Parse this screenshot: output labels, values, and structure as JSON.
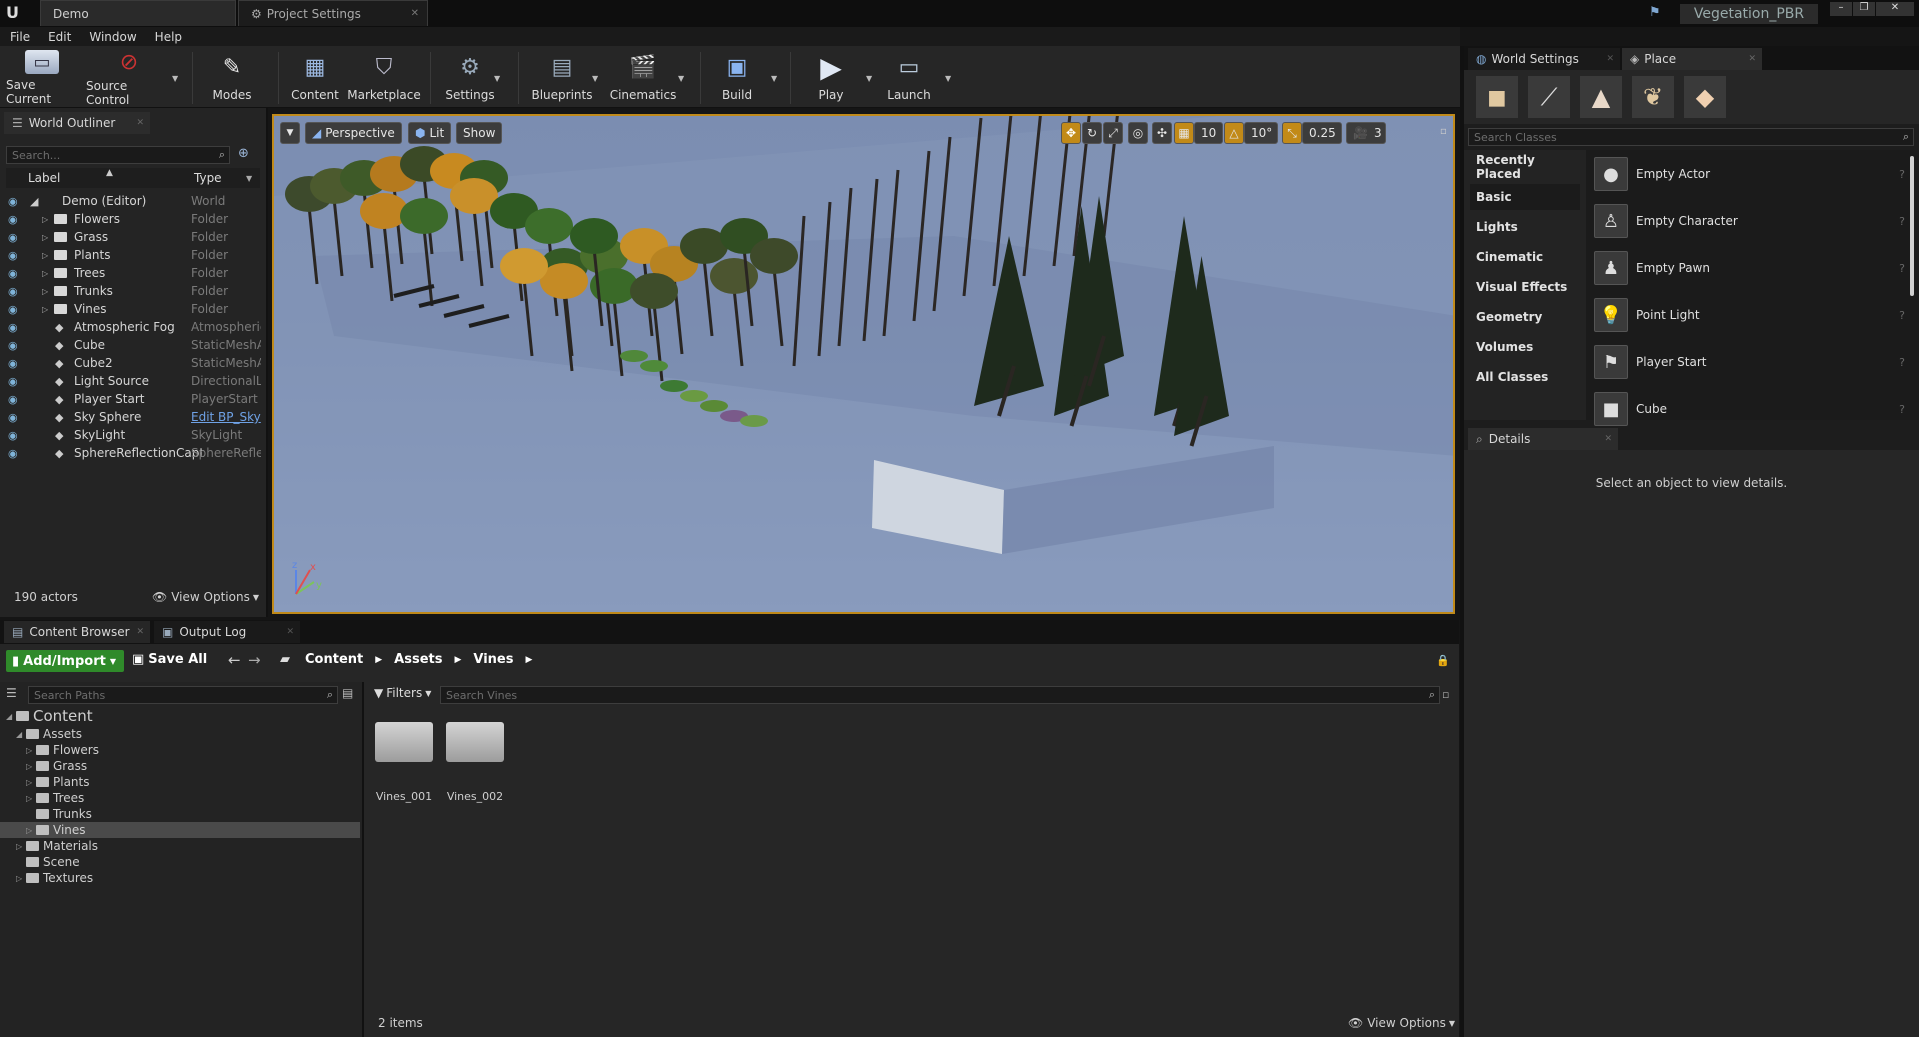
{
  "tabs": [
    {
      "label": "Demo"
    },
    {
      "label": "Project Settings"
    }
  ],
  "project_name": "Vegetation_PBR",
  "menu": [
    "File",
    "Edit",
    "Window",
    "Help"
  ],
  "toolbar": [
    {
      "label": "Save Current",
      "icon": "save-icon"
    },
    {
      "label": "Source Control",
      "icon": "source-control-icon"
    },
    {
      "label": "Modes",
      "icon": "modes-icon"
    },
    {
      "label": "Content",
      "icon": "content-icon"
    },
    {
      "label": "Marketplace",
      "icon": "marketplace-icon"
    },
    {
      "label": "Settings",
      "icon": "settings-icon"
    },
    {
      "label": "Blueprints",
      "icon": "blueprints-icon"
    },
    {
      "label": "Cinematics",
      "icon": "cinematics-icon"
    },
    {
      "label": "Build",
      "icon": "build-icon"
    },
    {
      "label": "Play",
      "icon": "play-icon"
    },
    {
      "label": "Launch",
      "icon": "launch-icon"
    }
  ],
  "outliner": {
    "title": "World Outliner",
    "search_placeholder": "Search...",
    "col_label": "Label",
    "col_type": "Type",
    "rows": [
      {
        "name": "Demo (Editor)",
        "type": "World"
      },
      {
        "name": "Flowers",
        "type": "Folder"
      },
      {
        "name": "Grass",
        "type": "Folder"
      },
      {
        "name": "Plants",
        "type": "Folder"
      },
      {
        "name": "Trees",
        "type": "Folder"
      },
      {
        "name": "Trunks",
        "type": "Folder"
      },
      {
        "name": "Vines",
        "type": "Folder"
      },
      {
        "name": "Atmospheric Fog",
        "type": "Atmospheric"
      },
      {
        "name": "Cube",
        "type": "StaticMeshA"
      },
      {
        "name": "Cube2",
        "type": "StaticMeshA"
      },
      {
        "name": "Light Source",
        "type": "DirectionalLi"
      },
      {
        "name": "Player Start",
        "type": "PlayerStart"
      },
      {
        "name": "Sky Sphere",
        "type": "Edit BP_Sky"
      },
      {
        "name": "SkyLight",
        "type": "SkyLight"
      },
      {
        "name": "SphereReflectionCapt",
        "type": "SphereReflec"
      }
    ],
    "actor_count": "190 actors",
    "view_options": "View Options"
  },
  "viewport": {
    "perspective": "Perspective",
    "lit": "Lit",
    "show": "Show",
    "grid_snap": "10",
    "rot_snap": "10°",
    "scale_snap": "0.25",
    "cam_speed": "3"
  },
  "place": {
    "tab_world": "World Settings",
    "tab_place": "Place",
    "search_placeholder": "Search Classes",
    "categories": [
      "Recently Placed",
      "Basic",
      "Lights",
      "Cinematic",
      "Visual Effects",
      "Geometry",
      "Volumes",
      "All Classes"
    ],
    "items": [
      {
        "label": "Empty Actor",
        "icon": "empty-actor-icon"
      },
      {
        "label": "Empty Character",
        "icon": "empty-character-icon"
      },
      {
        "label": "Empty Pawn",
        "icon": "empty-pawn-icon"
      },
      {
        "label": "Point Light",
        "icon": "point-light-icon"
      },
      {
        "label": "Player Start",
        "icon": "player-start-icon"
      },
      {
        "label": "Cube",
        "icon": "cube-icon"
      }
    ]
  },
  "details": {
    "title": "Details",
    "empty_text": "Select an object to view details."
  },
  "content_browser": {
    "tab_cb": "Content Browser",
    "tab_log": "Output Log",
    "add_import": "Add/Import",
    "save_all": "Save All",
    "path": [
      "Content",
      "Assets",
      "Vines"
    ],
    "search_paths": "Search Paths",
    "filters": "Filters",
    "search_vines": "Search Vines",
    "tree": [
      {
        "label": "Content"
      },
      {
        "label": "Assets"
      },
      {
        "label": "Flowers"
      },
      {
        "label": "Grass"
      },
      {
        "label": "Plants"
      },
      {
        "label": "Trees"
      },
      {
        "label": "Trunks"
      },
      {
        "label": "Vines"
      },
      {
        "label": "Materials"
      },
      {
        "label": "Scene"
      },
      {
        "label": "Textures"
      }
    ],
    "assets": [
      {
        "label": "Vines_001"
      },
      {
        "label": "Vines_002"
      }
    ],
    "item_count": "2 items",
    "view_options": "View Options"
  }
}
